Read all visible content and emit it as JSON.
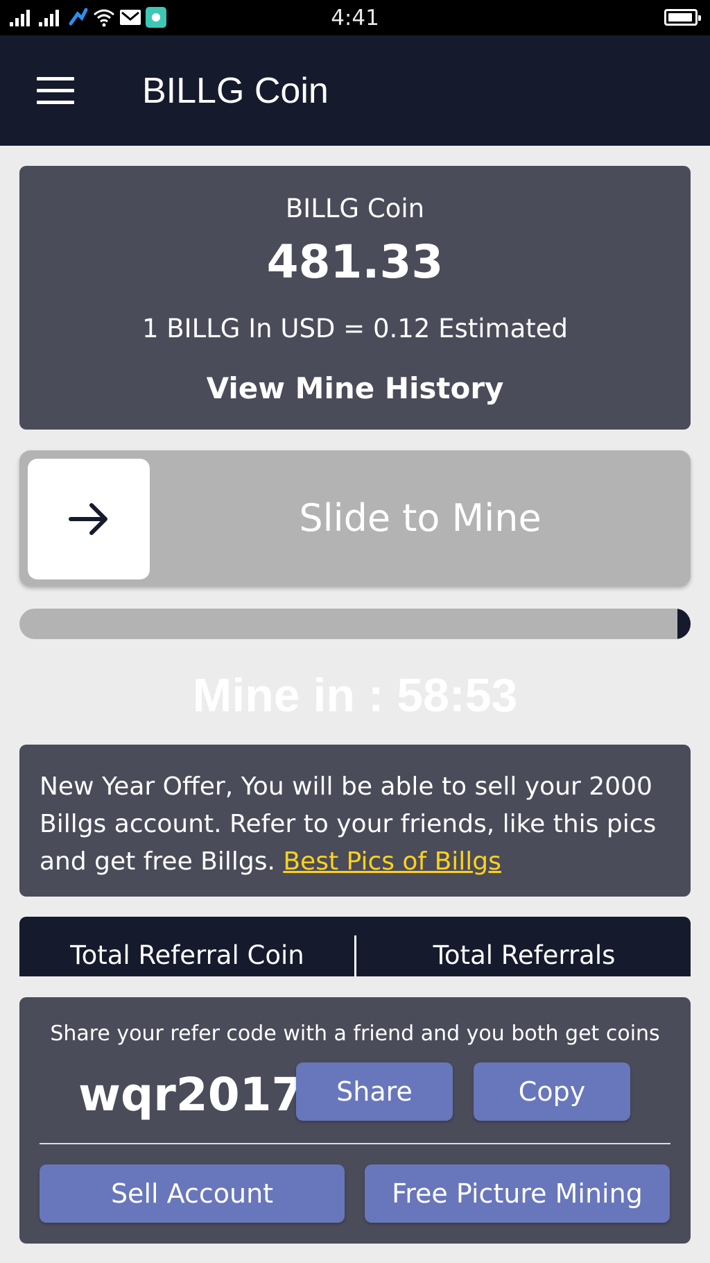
{
  "status_bar": {
    "time": "4:41",
    "icons": [
      "signal-icon",
      "signal-icon",
      "carrier-icon",
      "wifi-icon",
      "mail-icon",
      "app-notification-icon",
      "battery-icon"
    ],
    "battery_level": 0.8
  },
  "app_bar": {
    "title": "BILLG Coin",
    "menu_icon": "hamburger-menu-icon"
  },
  "balance_card": {
    "label": "BILLG Coin",
    "balance": "481.33",
    "rate_text": "1 BILLG In USD = 0.12 Estimated",
    "history_link": "View Mine History"
  },
  "slider": {
    "label": "Slide to Mine",
    "icon": "arrow-right-icon"
  },
  "progress": {
    "fraction_remaining": 0.02
  },
  "timer": {
    "text": "Mine in : 58:53"
  },
  "offer": {
    "text": "New Year Offer, You will be able to sell your 2000 Billgs account. Refer to your friends, like this pics and get free Billgs. ",
    "link_text": "Best Pics of Billgs",
    "link_color": "#ffd21a"
  },
  "referrals": {
    "coin_label": "Total Referral Coin",
    "count_label": "Total Referrals"
  },
  "share": {
    "prompt": "Share your refer code with a friend and you both get coins",
    "code": "wqr2017",
    "share_label": "Share",
    "copy_label": "Copy",
    "sell_label": "Sell Account",
    "free_mining_label": "Free Picture Mining"
  },
  "colors": {
    "app_bar": "#161a2d",
    "card": "#4b4c5a",
    "button": "#6876bb",
    "slider": "#b3b3b3",
    "background": "#ececec"
  }
}
